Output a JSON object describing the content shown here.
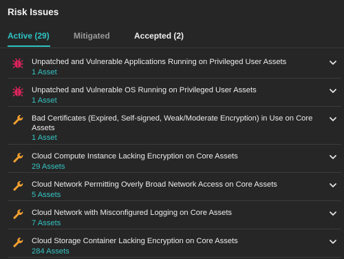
{
  "panel": {
    "title": "Risk Issues"
  },
  "tabs": [
    {
      "label": "Active (29)"
    },
    {
      "label": "Mitigated"
    },
    {
      "label": "Accepted (2)"
    }
  ],
  "colors": {
    "background": "#262626",
    "accent": "#2ec4c4",
    "critical_icon": "#e0245e",
    "warning_icon": "#f0a030"
  },
  "issues": [
    {
      "icon": "bug-icon",
      "title": "Unpatched and Vulnerable Applications Running on Privileged User Assets",
      "count": "1 Asset"
    },
    {
      "icon": "bug-icon",
      "title": "Unpatched and Vulnerable OS Running on Privileged User Assets",
      "count": "1 Asset"
    },
    {
      "icon": "wrench-icon",
      "title": "Bad Certificates (Expired, Self-signed, Weak/Moderate Encryption) in Use on Core Assets",
      "count": "1 Asset"
    },
    {
      "icon": "wrench-icon",
      "title": "Cloud Compute Instance Lacking Encryption on Core Assets",
      "count": "29 Assets"
    },
    {
      "icon": "wrench-icon",
      "title": "Cloud Network Permitting Overly Broad Network Access on Core Assets",
      "count": "5 Assets"
    },
    {
      "icon": "wrench-icon",
      "title": "Cloud Network with Misconfigured Logging on Core Assets",
      "count": "7 Assets"
    },
    {
      "icon": "wrench-icon",
      "title": "Cloud Storage Container Lacking Encryption on Core Assets",
      "count": "284 Assets"
    }
  ]
}
